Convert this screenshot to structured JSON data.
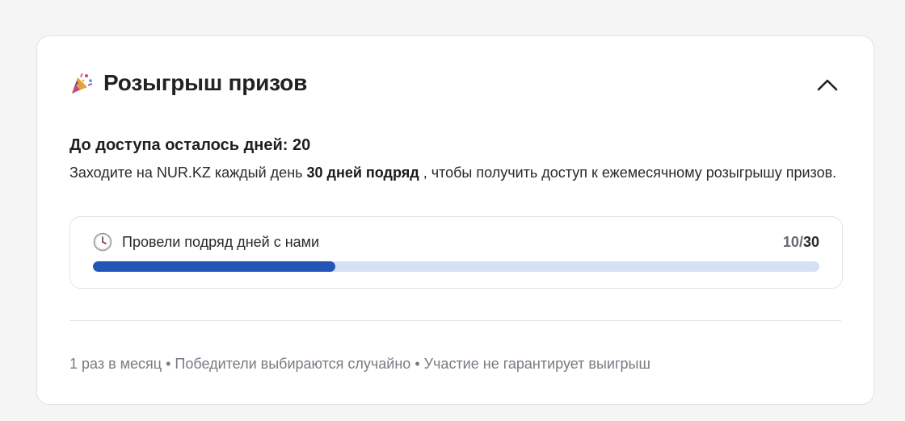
{
  "header": {
    "title": "Розыгрыш призов",
    "icon": "party-popper-icon"
  },
  "status": {
    "title": "До доступа осталось дней: 20"
  },
  "description": {
    "prefix": "Заходите на NUR.KZ каждый день",
    "highlight": "30 дней подряд",
    "suffix": ", чтобы получить доступ к ежемесячному розыгрышу призов."
  },
  "progress": {
    "label": "Провели подряд дней с нами",
    "current": "10",
    "separator": "/",
    "total": "30",
    "fraction": 0.3333,
    "fill_color": "#2354b8",
    "track_color": "#d6e1f6",
    "icon": "clock-icon"
  },
  "footer": {
    "note": "1 раз в месяц • Победители выбираются случайно • Участие не гарантирует выигрыш"
  },
  "controls": {
    "collapse_icon": "chevron-up-icon"
  }
}
